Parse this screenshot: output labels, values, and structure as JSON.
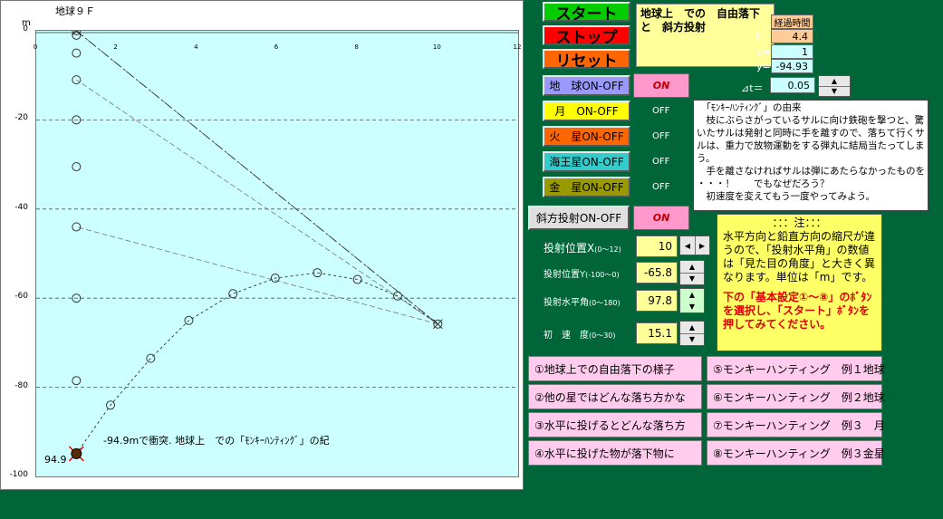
{
  "chart": {
    "title": "地球９Ｆ",
    "y_unit": "m",
    "yticks": [
      "0",
      "-20",
      "-40",
      "-60",
      "-80",
      "-100"
    ],
    "xticks": [
      "0",
      "2",
      "4",
      "6",
      "8",
      "10",
      "12"
    ],
    "message": "-94.9mで衝突. 地球上　での「ﾓﾝｷｰﾊﾝﾃｨﾝｸﾞ」の紀",
    "y_readout": "94.9"
  },
  "chart_data": {
    "type": "scatter",
    "xlim": [
      0,
      12
    ],
    "ylim": [
      -100,
      0
    ],
    "grid": true,
    "series": [
      {
        "points": [
          [
            1.0,
            0
          ],
          [
            1.0,
            -1
          ],
          [
            1.0,
            -5
          ],
          [
            1.0,
            -11
          ],
          [
            1.0,
            -20
          ],
          [
            1.0,
            -30.5
          ],
          [
            1.0,
            -44
          ],
          [
            1.0,
            -60
          ],
          [
            1.0,
            -78.5
          ],
          [
            1.0,
            -94.9
          ]
        ]
      },
      {
        "points": [
          [
            10.0,
            -65.8
          ],
          [
            9.0,
            -59.5
          ],
          [
            8.0,
            -55.8
          ],
          [
            7.0,
            -54.3
          ],
          [
            5.95,
            -55.5
          ],
          [
            4.9,
            -59
          ],
          [
            3.8,
            -65
          ],
          [
            2.85,
            -73.5
          ],
          [
            1.85,
            -84
          ],
          [
            1.0,
            -94.9
          ]
        ]
      }
    ]
  },
  "controls": {
    "start": "スタート",
    "stop": "ストップ",
    "reset": "リセット"
  },
  "title_box": "地球上　での　自由落下と　斜方投射",
  "elapsed": {
    "header": "経過時間",
    "t_label": "t=",
    "t_value": "4.4",
    "x_label": "x=",
    "x_value": "1",
    "y_label": "y=",
    "y_value": "-94.93",
    "dt_label": "⊿t＝",
    "dt_value": "0.05"
  },
  "planets": [
    {
      "label": "地　球ON-OFF",
      "state": "ON",
      "color": "#9999ff"
    },
    {
      "label": "月　ON-OFF",
      "state": "OFF",
      "color": "#ffff00"
    },
    {
      "label": "火　星ON-OFF",
      "state": "OFF",
      "color": "#ff6600"
    },
    {
      "label": "海王星ON-OFF",
      "state": "OFF",
      "color": "#33cccc"
    },
    {
      "label": "金　星ON-OFF",
      "state": "OFF",
      "color": "#999900"
    }
  ],
  "monkey_text": "　「ﾓﾝｷｰﾊﾝﾃｨﾝｸﾞ」の由来\n　枝にぶらさがっているサルに向け鉄砲を撃つと、驚いたサルは発射と同時に手を離すので、落ちて行くサルは、重力で放物運動をする弾丸に結局当たってしまう。\n　手を離さなければサルは弾にあたらなかったものを\n・・・！　　でもなぜだろう？\n　初速度を変えてもう一度やってみよう。",
  "oblique": {
    "label": "斜方投射ON-OFF",
    "state": "ON"
  },
  "note": {
    "head": "：：：注：：：",
    "body": "水平方向と鉛直方向の縮尺が違うので、「投射水平角」の数値は「見た目の角度」と大きく異なります。単位は「m」です。",
    "red": "下の「基本設定①～⑧」のﾎﾞﾀﾝを選択し、「スタート」ﾎﾞﾀﾝを押してみてください。"
  },
  "params": [
    {
      "label": "投射位置X",
      "range": "(0～12)",
      "value": "10"
    },
    {
      "label": "投射位置Y",
      "range": "(-100～0)",
      "value": "-65.8"
    },
    {
      "label": "投射水平角",
      "range": "(0～180)",
      "value": "97.8"
    },
    {
      "label": "初　速　度",
      "range": "(0～30)",
      "value": "15.1"
    }
  ],
  "examples_left": [
    "①地球上での自由落下の様子",
    "②他の星ではどんな落ち方かな",
    "③水平に投げるとどんな落ち方",
    "④水平に投げた物が落下物に"
  ],
  "examples_right": [
    "⑤モンキーハンティング　例１地球",
    "⑥モンキーハンティング　例２地球",
    "⑦モンキーハンティング　例３　月",
    "⑧モンキーハンティング　例３金星"
  ],
  "colors": {
    "background": "#00663a",
    "plot": "#ccffff",
    "start": "#00cc00",
    "stop": "#ff0000",
    "reset": "#ff6600",
    "on_box": "#ff99cc",
    "note": "#ffff66"
  },
  "icons": {
    "spinner_up": "▲",
    "spinner_down": "▼",
    "spinner_left": "◀",
    "spinner_right": "▶"
  }
}
